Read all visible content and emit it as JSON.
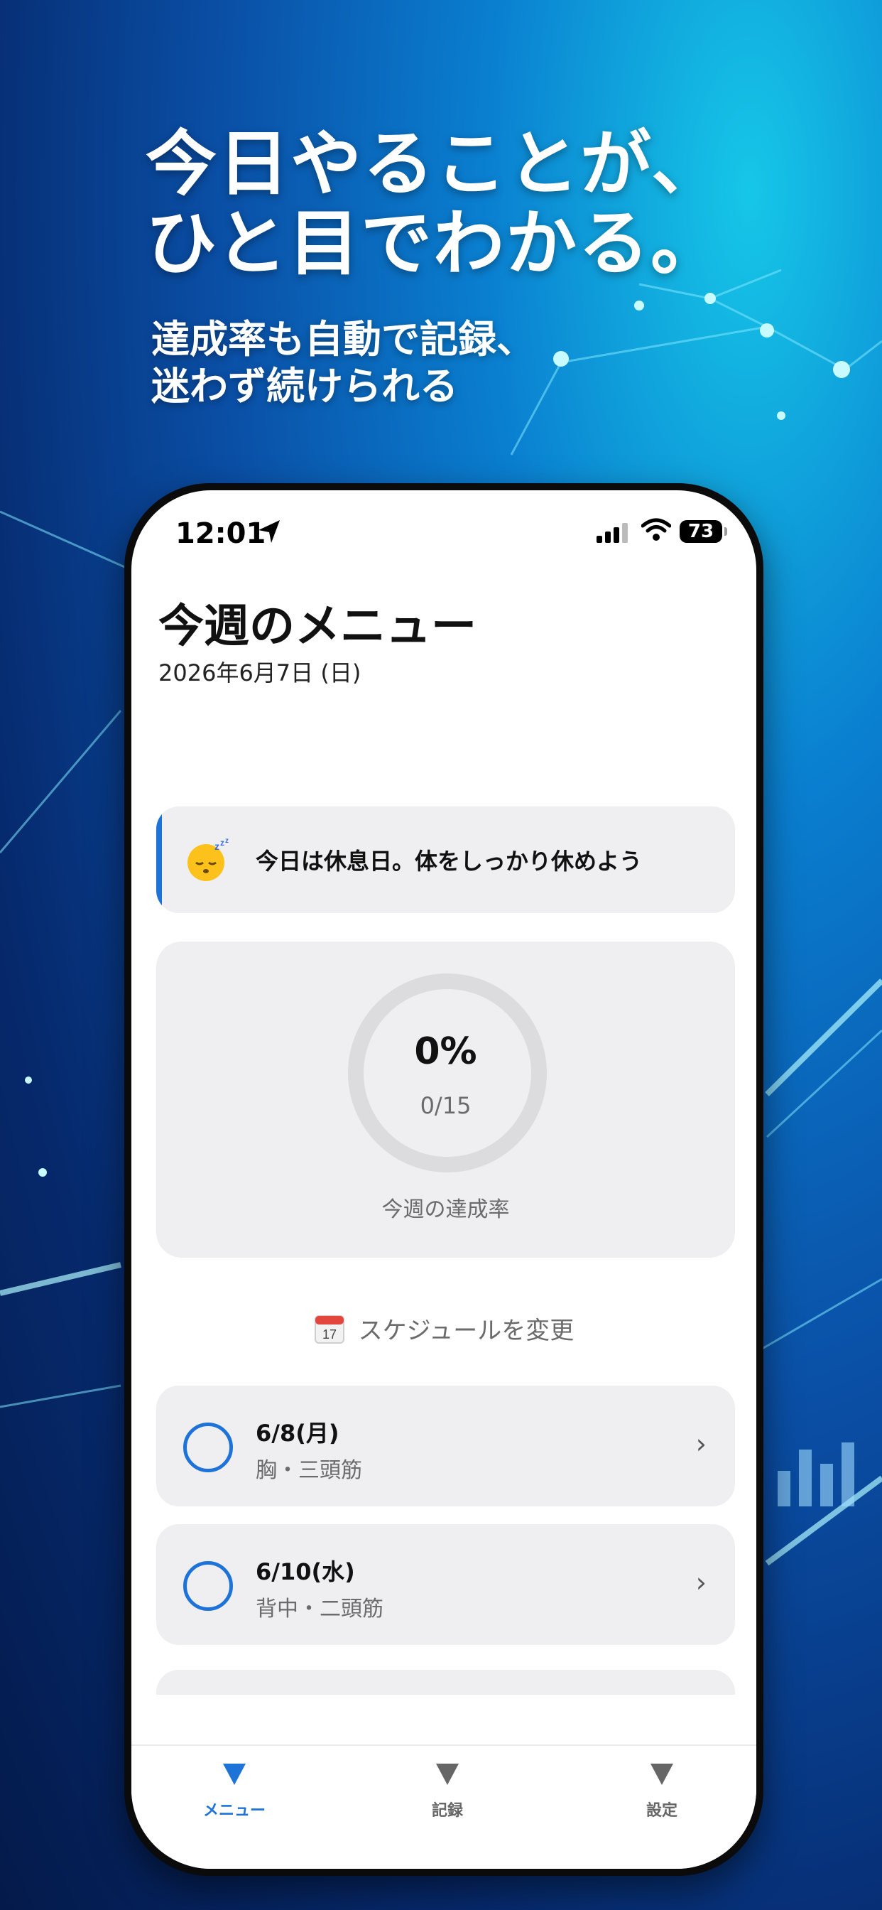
{
  "promo": {
    "headline_line1": "今日やることが、",
    "headline_line2": "ひと目でわかる。",
    "sub_line1": "達成率も自動で記録、",
    "sub_line2": "迷わず続けられる"
  },
  "status_bar": {
    "time": "12:01",
    "battery": "73"
  },
  "header": {
    "title": "今週のメニュー",
    "date": "2026年6月7日 (日)"
  },
  "rest_notice": {
    "icon": "sleeping-face-icon",
    "text": "今日は休息日。体をしっかり休めよう"
  },
  "weekly_progress": {
    "percent": "0%",
    "count": "0/15",
    "label": "今週の達成率",
    "fraction": 0
  },
  "schedule_button": {
    "icon": "calendar-icon",
    "calendar_day": "17",
    "label": "スケジュールを変更"
  },
  "workouts": [
    {
      "day": "6/8(月)",
      "part": "胸・三頭筋"
    },
    {
      "day": "6/10(水)",
      "part": "背中・二頭筋"
    }
  ],
  "tabs": [
    {
      "label": "メニュー",
      "active": true
    },
    {
      "label": "記録",
      "active": false
    },
    {
      "label": "設定",
      "active": false
    }
  ],
  "colors": {
    "accent": "#1e73d8",
    "card_bg": "#efeff1"
  }
}
